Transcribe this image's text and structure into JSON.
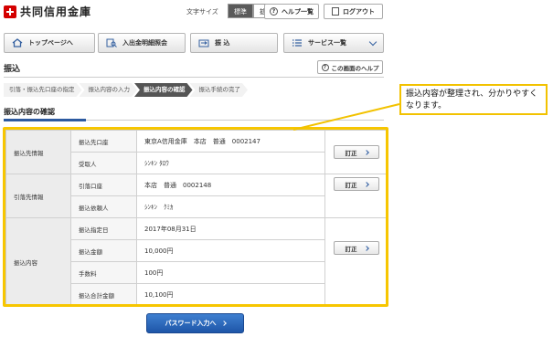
{
  "header": {
    "logo_text": "共同信用金庫",
    "font_size_label": "文字サイズ",
    "font_std": "標準",
    "font_large": "拡大",
    "help_label": "ヘルプ一覧",
    "logout_label": "ログアウト"
  },
  "nav": {
    "home": "トップページへ",
    "inquiry": "入出金明細照会",
    "transfer": "振 込",
    "services": "サービス一覧"
  },
  "page": {
    "title": "振込",
    "screen_help": "この画面のヘルプ",
    "steps": [
      "引落・振込先口座の指定",
      "振込内容の入力",
      "振込内容の確認",
      "振込手続の完了"
    ],
    "active_step": 2,
    "section_title": "振込内容の確認"
  },
  "table": {
    "categories": [
      "振込先情報",
      "引落先情報",
      "振込内容"
    ],
    "rows": [
      {
        "label": "振込先口座",
        "value": "東京A信用金庫　本店　普通　0002147"
      },
      {
        "label": "受取人",
        "value": "ｼﾝｷﾝ ﾀﾛｳ"
      },
      {
        "label": "引落口座",
        "value": "本店　普通　0002148"
      },
      {
        "label": "振込依頼人",
        "value": "ｼﾝｷﾝ　ｸﾐｶ"
      },
      {
        "label": "振込指定日",
        "value": "2017年08月31日"
      },
      {
        "label": "振込金額",
        "value": "10,000円"
      },
      {
        "label": "手数料",
        "value": "100円"
      },
      {
        "label": "振込合計金額",
        "value": "10,100円"
      }
    ],
    "edit_label": "訂正"
  },
  "password_button": "パスワード入力へ",
  "callout": "振込内容が整理され、分かりやすくなります。",
  "colors": {
    "accent_blue": "#2c5aa0",
    "highlight_yellow": "#f7c600",
    "brand_red": "#d40000"
  }
}
